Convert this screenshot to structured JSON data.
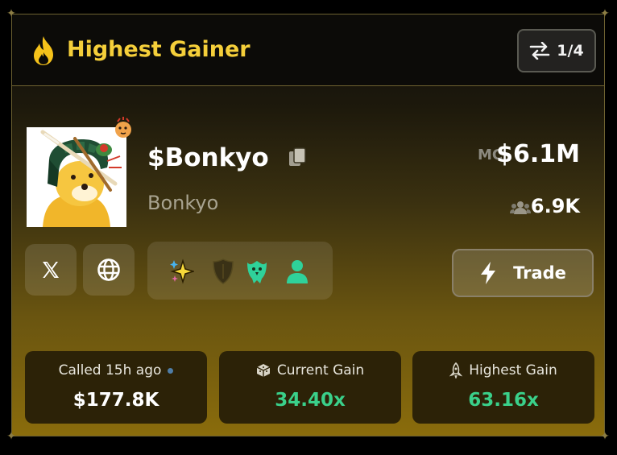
{
  "header": {
    "title": "Highest Gainer",
    "pager": "1/4"
  },
  "token": {
    "symbol": "$Bonkyo",
    "name": "Bonkyo",
    "mc_label": "MC",
    "mc_value": "$6.1M",
    "holders": "6.9K"
  },
  "trade_label": "Trade",
  "stats": [
    {
      "label": "Called 15h ago",
      "value": "$177.8K",
      "value_color": "#ffffff"
    },
    {
      "label": "Current Gain",
      "value": "34.40x",
      "value_color": "#3ad08a"
    },
    {
      "label": "Highest Gain",
      "value": "63.16x",
      "value_color": "#3ad08a"
    }
  ],
  "colors": {
    "accent_yellow": "#f5cf3a",
    "gain_green": "#3ad08a",
    "tag_green": "#2fd19a"
  },
  "icons": {
    "social": [
      "x-icon",
      "globe-icon"
    ],
    "tags": [
      "sparkles-icon",
      "shield-icon",
      "eagle-icon",
      "user-icon"
    ]
  }
}
